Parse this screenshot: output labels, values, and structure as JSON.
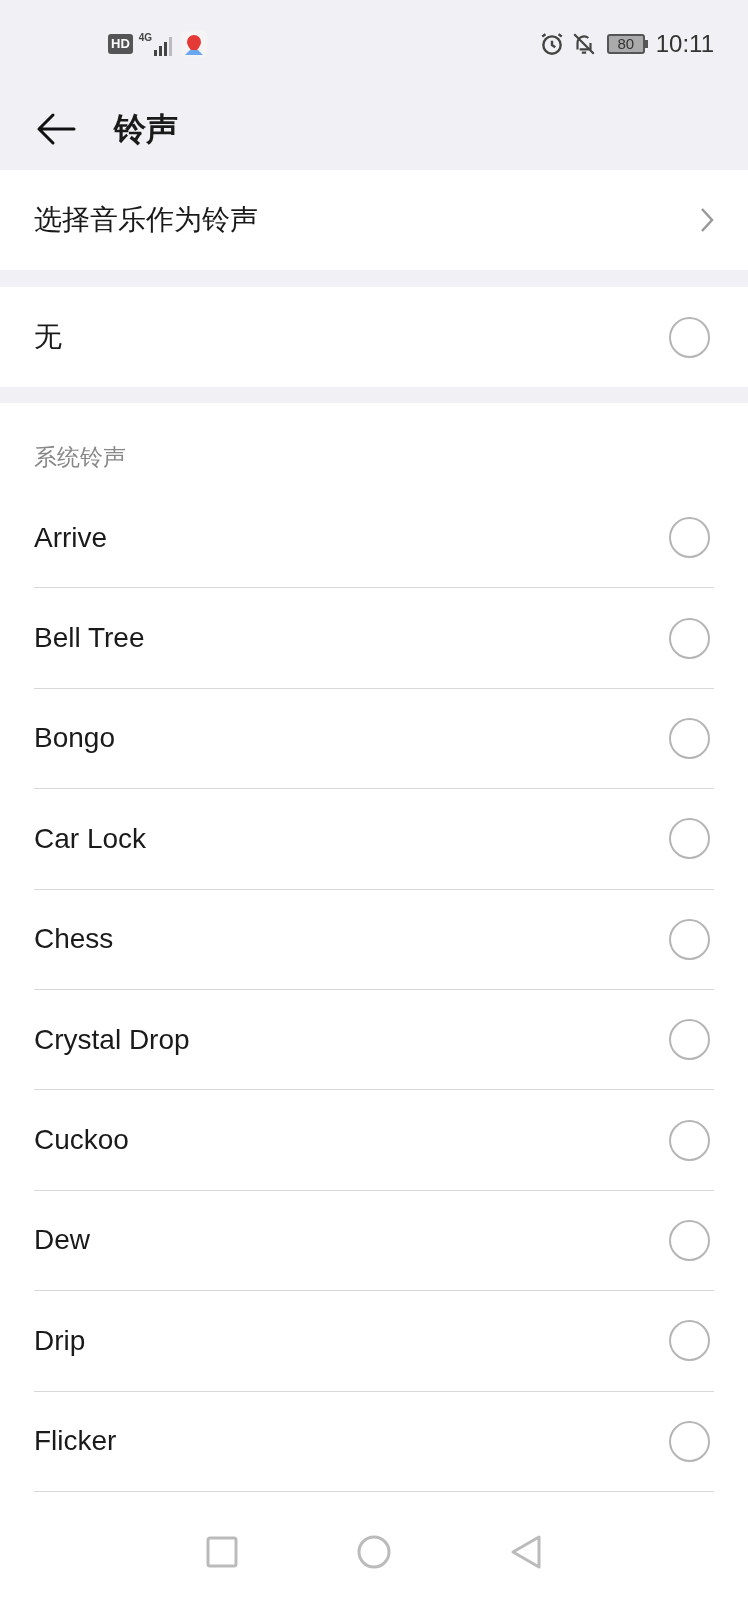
{
  "status_bar": {
    "network_badge": "HD",
    "network_type": "4G",
    "battery": "80",
    "time": "10:11"
  },
  "header": {
    "title": "铃声"
  },
  "music_option": {
    "label": "选择音乐作为铃声"
  },
  "none_option": {
    "label": "无",
    "selected": false
  },
  "section": {
    "title": "系统铃声",
    "items": [
      {
        "label": "Arrive",
        "selected": false
      },
      {
        "label": "Bell Tree",
        "selected": false
      },
      {
        "label": "Bongo",
        "selected": false
      },
      {
        "label": "Car Lock",
        "selected": false
      },
      {
        "label": "Chess",
        "selected": false
      },
      {
        "label": "Crystal Drop",
        "selected": false
      },
      {
        "label": "Cuckoo",
        "selected": false
      },
      {
        "label": "Dew",
        "selected": false
      },
      {
        "label": "Drip",
        "selected": false
      },
      {
        "label": "Flicker",
        "selected": false
      }
    ]
  }
}
